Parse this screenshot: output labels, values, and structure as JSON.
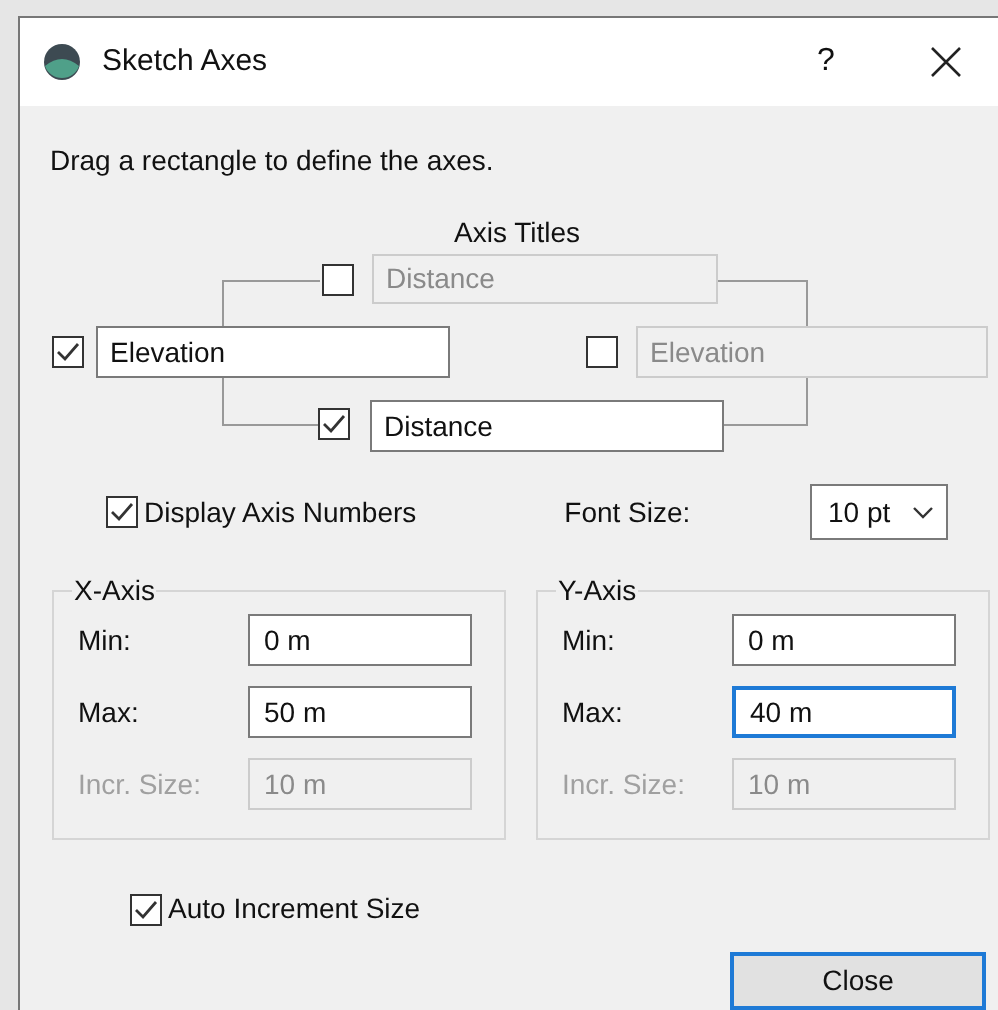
{
  "window": {
    "title": "Sketch Axes",
    "help": "?"
  },
  "instruction": "Drag a rectangle to define the axes.",
  "axis_titles": {
    "label": "Axis Titles",
    "items": [
      {
        "kind": "top",
        "checked": false,
        "value": "Distance"
      },
      {
        "kind": "left",
        "checked": true,
        "value": "Elevation"
      },
      {
        "kind": "right",
        "checked": false,
        "value": "Elevation"
      },
      {
        "kind": "bottom",
        "checked": true,
        "value": "Distance"
      }
    ]
  },
  "display_axis_numbers": {
    "label": "Display Axis Numbers",
    "checked": true
  },
  "font_size": {
    "label": "Font Size:",
    "value": "10 pt"
  },
  "axes": [
    {
      "title": "X-Axis",
      "fields": [
        {
          "label": "Min:",
          "value": "0 m",
          "disabled": false,
          "focused": false
        },
        {
          "label": "Max:",
          "value": "50 m",
          "disabled": false,
          "focused": false
        },
        {
          "label": "Incr. Size:",
          "value": "10 m",
          "disabled": true,
          "focused": false
        }
      ]
    },
    {
      "title": "Y-Axis",
      "fields": [
        {
          "label": "Min:",
          "value": "0 m",
          "disabled": false,
          "focused": false
        },
        {
          "label": "Max:",
          "value": "40 m",
          "disabled": false,
          "focused": true
        },
        {
          "label": "Incr. Size:",
          "value": "10 m",
          "disabled": true,
          "focused": false
        }
      ]
    }
  ],
  "auto_increment": {
    "label": "Auto Increment Size",
    "checked": true
  },
  "buttons": [
    {
      "label": "Close",
      "default": true
    }
  ]
}
